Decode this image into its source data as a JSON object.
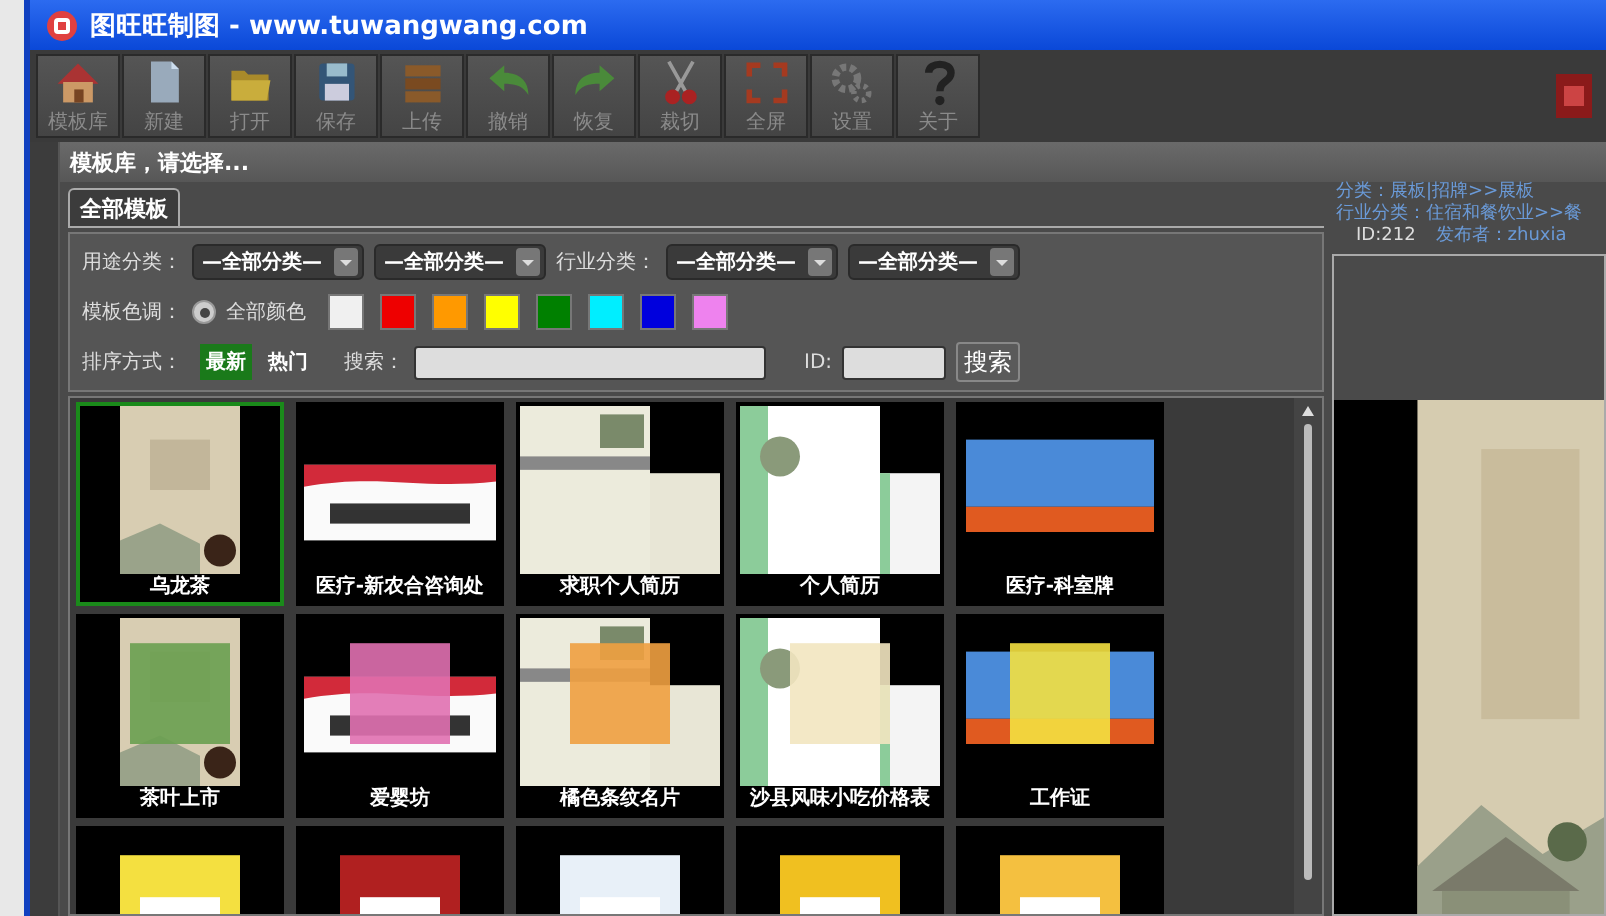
{
  "window": {
    "title": "图旺旺制图 - www.tuwangwang.com"
  },
  "toolbar": [
    {
      "label": "模板库",
      "kind": "house"
    },
    {
      "label": "新建",
      "kind": "document"
    },
    {
      "label": "打开",
      "kind": "folder"
    },
    {
      "label": "保存",
      "kind": "floppy"
    },
    {
      "label": "上传",
      "kind": "stack"
    },
    {
      "label": "撤销",
      "kind": "undo"
    },
    {
      "label": "恢复",
      "kind": "redo"
    },
    {
      "label": "裁切",
      "kind": "scissors"
    },
    {
      "label": "全屏",
      "kind": "fullscreen"
    },
    {
      "label": "设置",
      "kind": "gear"
    },
    {
      "label": "关于",
      "kind": "question"
    }
  ],
  "dialog": {
    "title": "模板库，请选择...",
    "tabs": [
      {
        "label": "全部模板",
        "selected": true
      }
    ],
    "filters": {
      "use_label": "用途分类：",
      "use_selects": [
        "—全部分类—",
        "—全部分类—"
      ],
      "industry_label": "行业分类：",
      "industry_selects": [
        "—全部分类—",
        "—全部分类—"
      ],
      "color_label": "模板色调：",
      "all_colors": {
        "label": "全部颜色",
        "selected": true
      },
      "swatches": [
        {
          "color": "#f0f0f0",
          "selected": false
        },
        {
          "color": "#ee0000",
          "selected": false
        },
        {
          "color": "#ff9900",
          "selected": false
        },
        {
          "color": "#ffff00",
          "selected": false
        },
        {
          "color": "#008000",
          "selected": false
        },
        {
          "color": "#00eeff",
          "selected": false
        },
        {
          "color": "#0000dd",
          "selected": false
        },
        {
          "color": "#ee82ee",
          "selected": false
        }
      ],
      "sort_label": "排序方式：",
      "sort_options": [
        {
          "label": "最新",
          "selected": true
        },
        {
          "label": "热门",
          "selected": false
        }
      ],
      "search_label": "搜索：",
      "id_label": "ID:",
      "search_button": "搜索"
    },
    "templates": [
      {
        "name": "乌龙茶",
        "selected": true
      },
      {
        "name": "医疗-新农合咨询处",
        "selected": false
      },
      {
        "name": "求职个人简历",
        "selected": false
      },
      {
        "name": "个人简历",
        "selected": false
      },
      {
        "name": "医疗-科室牌",
        "selected": false
      },
      {
        "name": "茶叶上市",
        "selected": false
      },
      {
        "name": "爱婴坊",
        "selected": false
      },
      {
        "name": "橘色条纹名片",
        "selected": false
      },
      {
        "name": "沙县风味小吃价格表",
        "selected": false
      },
      {
        "name": "工作证",
        "selected": false
      },
      {
        "selected": false
      },
      {
        "selected": false
      },
      {
        "selected": false
      },
      {
        "selected": false
      },
      {
        "selected": false
      }
    ],
    "info": {
      "category": "分类：展板|招牌>>展板",
      "industry": "行业分类：住宿和餐饮业>>餐",
      "id": "ID:212",
      "publisher": "发布者：zhuxia"
    }
  }
}
